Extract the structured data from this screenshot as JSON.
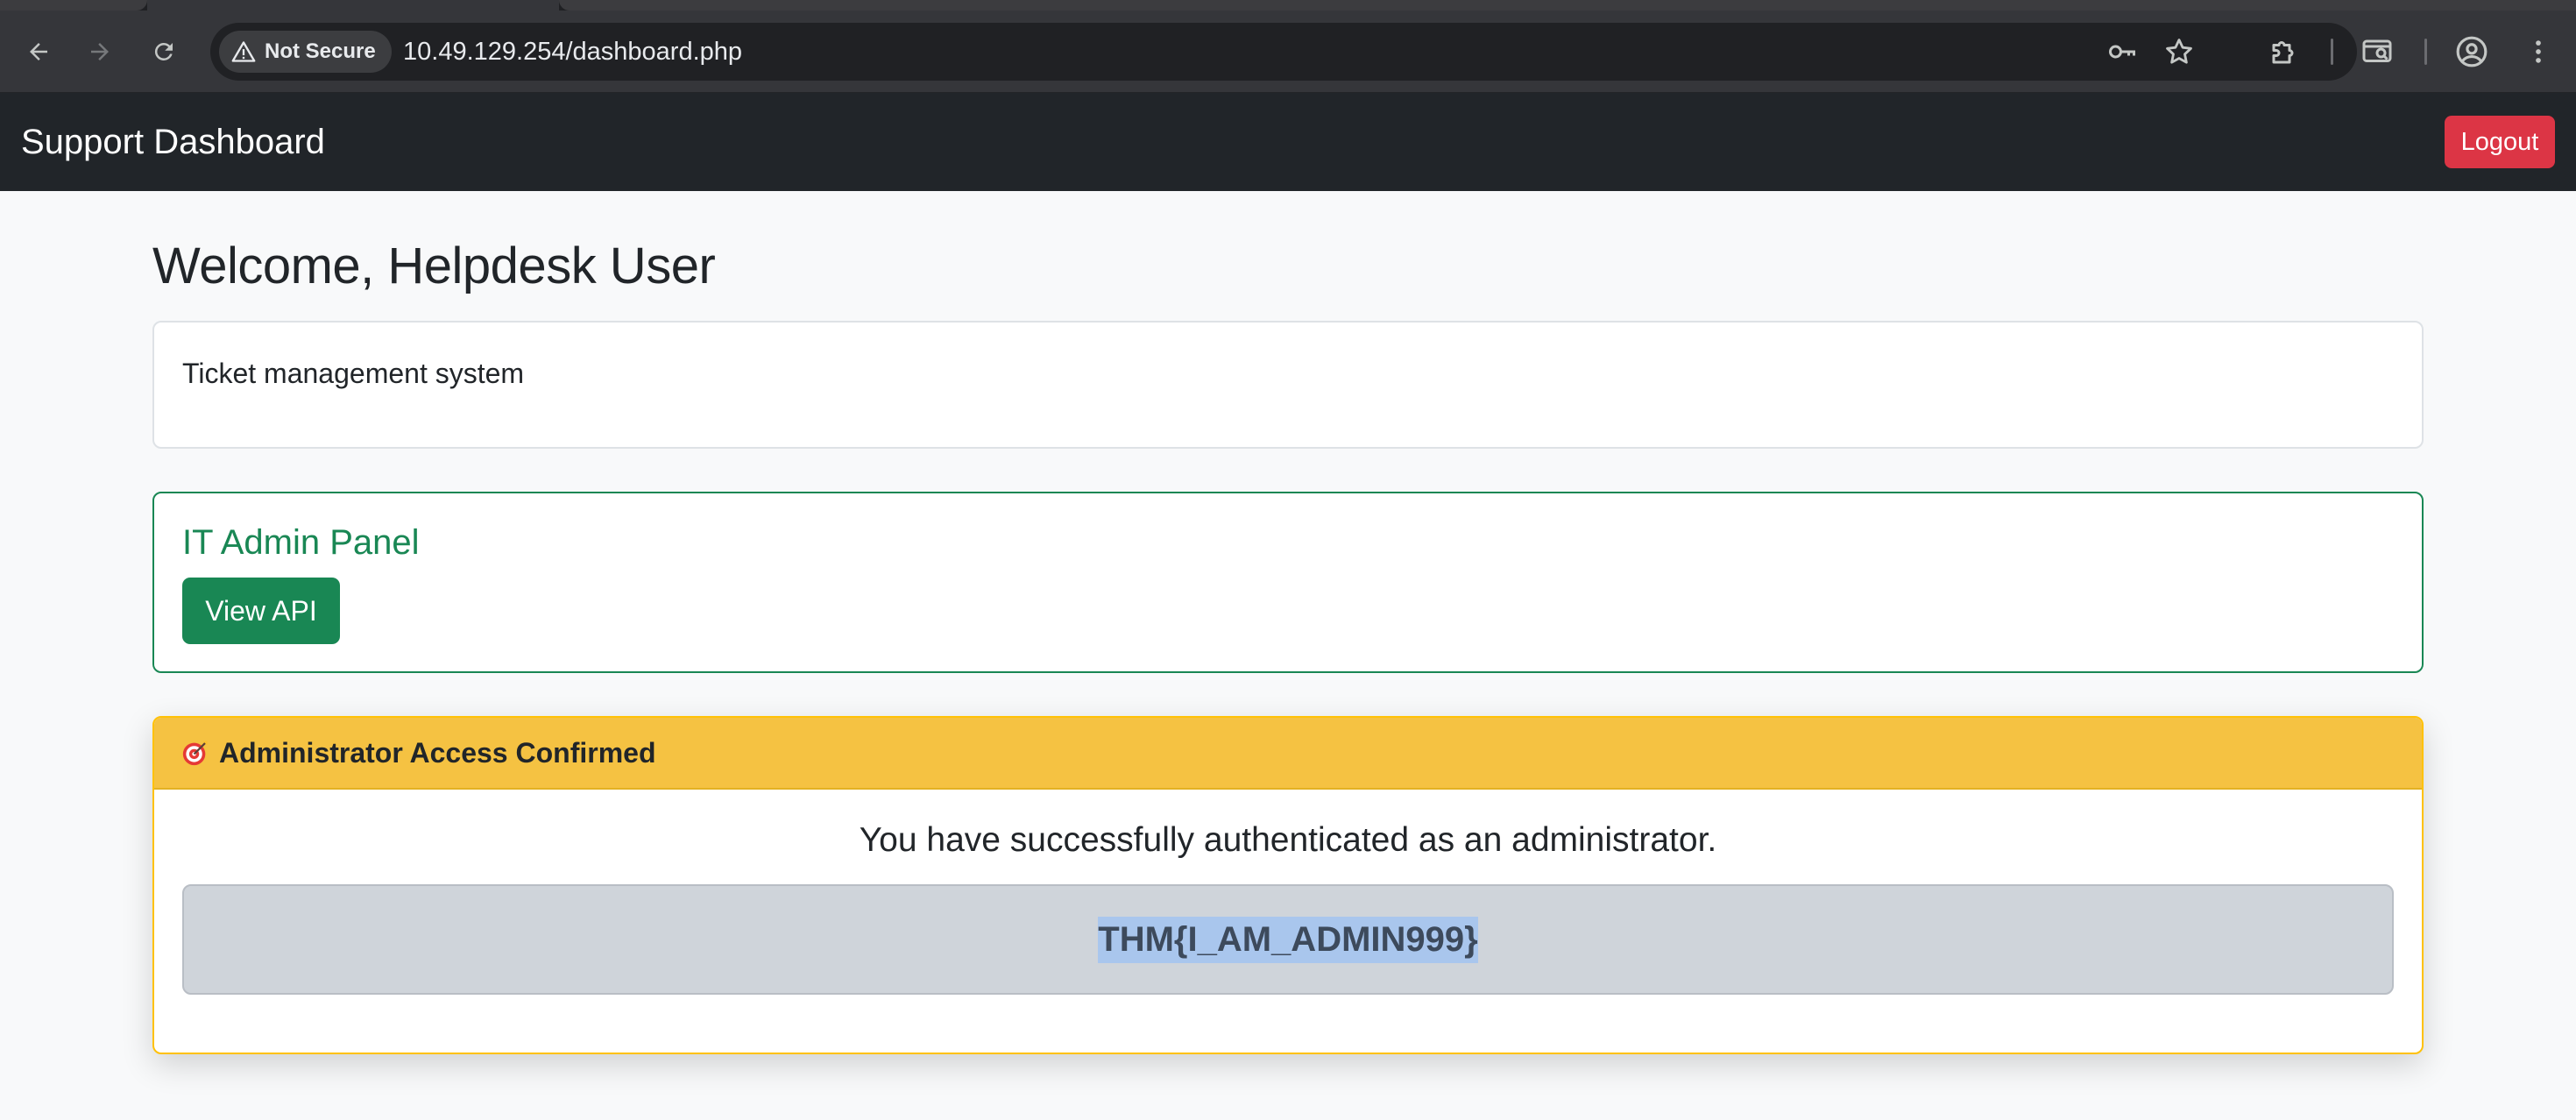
{
  "browser": {
    "security_label": "Not Secure",
    "url": "10.49.129.254/dashboard.php",
    "icons": {
      "back": "back-arrow-icon",
      "forward": "forward-arrow-icon",
      "reload": "reload-icon",
      "security": "warning-triangle-icon",
      "password": "key-icon",
      "bookmark": "star-icon",
      "extensions": "puzzle-icon",
      "tab_search": "tab-search-icon",
      "profile": "profile-icon",
      "menu": "kebab-menu-icon"
    }
  },
  "navbar": {
    "brand": "Support Dashboard",
    "logout_label": "Logout"
  },
  "main": {
    "welcome": "Welcome, Helpdesk User",
    "description": "Ticket management system",
    "admin_panel": {
      "title": "IT Admin Panel",
      "button_label": "View API"
    },
    "success": {
      "header": "Administrator Access Confirmed",
      "header_icon": "target-icon",
      "message": "You have successfully authenticated as an administrator.",
      "flag": "THM{I_AM_ADMIN999}"
    }
  },
  "colors": {
    "navbar_bg": "#212529",
    "logout": "#dc3545",
    "success_green": "#198754",
    "warning_header": "#f5c242",
    "flag_highlight": "#a9c6ed"
  }
}
